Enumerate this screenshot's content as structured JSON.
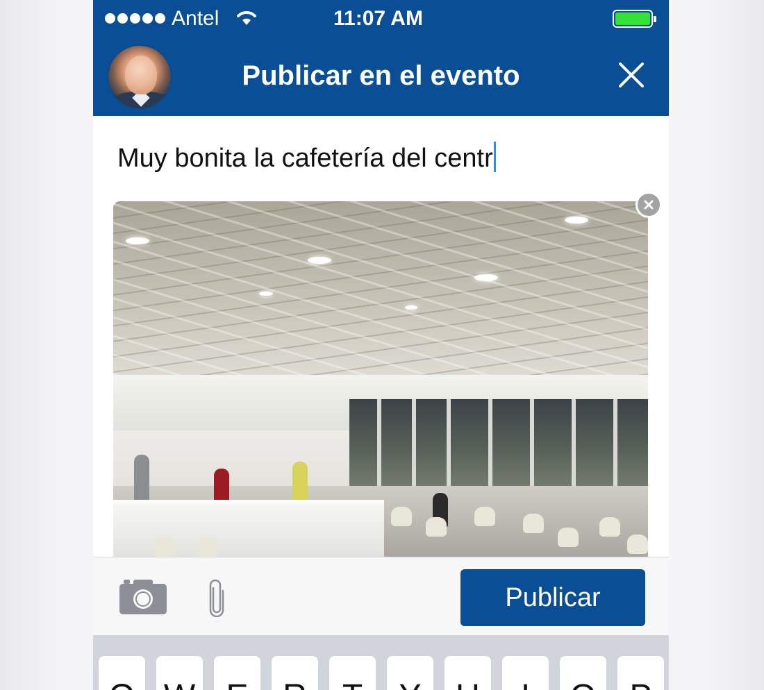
{
  "status_bar": {
    "carrier": "Antel",
    "time": "11:07 AM",
    "signal_bars": 5,
    "battery_level": 1.0,
    "battery_color": "#35e235"
  },
  "nav": {
    "title": "Publicar en el evento",
    "close_icon": "close-icon",
    "avatar_icon": "user-avatar"
  },
  "composer": {
    "text": "Muy bonita la cafetería del centr"
  },
  "attachment": {
    "remove_icon": "remove-photo-icon"
  },
  "toolbar": {
    "camera_icon": "camera-icon",
    "attach_icon": "paperclip-icon",
    "publish_label": "Publicar"
  },
  "keyboard": {
    "row1": [
      "Q",
      "W",
      "E",
      "R",
      "T",
      "Y",
      "U",
      "I",
      "O",
      "P"
    ]
  },
  "colors": {
    "brand_blue": "#0a4f96",
    "caret": "#2f8cff"
  }
}
